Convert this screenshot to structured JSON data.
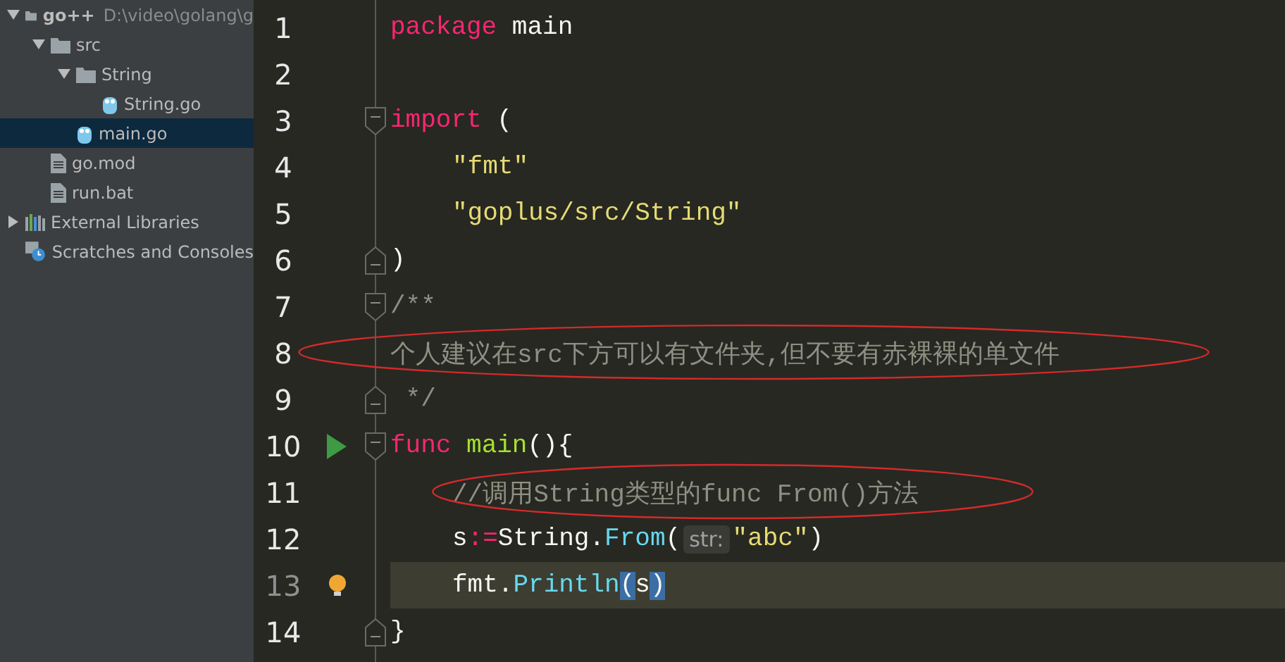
{
  "project_tree": [
    {
      "label": "go++",
      "path": "D:\\video\\golang\\g",
      "kind": "folder",
      "expanded": true,
      "selected": false,
      "children": [
        {
          "label": "src",
          "kind": "folder",
          "expanded": true,
          "selected": false,
          "children": [
            {
              "label": "String",
              "kind": "folder",
              "expanded": true,
              "selected": false,
              "children": [
                {
                  "label": "String.go",
                  "kind": "gofile",
                  "selected": false
                }
              ]
            },
            {
              "label": "main.go",
              "kind": "gofile",
              "selected": true
            }
          ]
        },
        {
          "label": "go.mod",
          "kind": "file",
          "selected": false
        },
        {
          "label": "run.bat",
          "kind": "file",
          "selected": false
        }
      ]
    },
    {
      "label": "External Libraries",
      "kind": "libraries",
      "expanded": false,
      "selected": false
    },
    {
      "label": "Scratches and Consoles",
      "kind": "scratches",
      "selected": false
    }
  ],
  "editor": {
    "lines": [
      {
        "number": "1",
        "current": false,
        "circled": false,
        "indented": false,
        "tokens": [
          {
            "kind": "keyword",
            "text": "package"
          },
          {
            "kind": "plain",
            "text": " main"
          }
        ]
      },
      {
        "number": "2",
        "current": false,
        "circled": false
      },
      {
        "number": "3",
        "current": false,
        "circled": false,
        "indented": false,
        "fold": {
          "kind": "open"
        },
        "tokens": [
          {
            "kind": "keyword",
            "text": "import"
          },
          {
            "kind": "plain",
            "text": " ("
          }
        ]
      },
      {
        "number": "4",
        "current": false,
        "circled": false,
        "indented": true,
        "tokens": [
          {
            "kind": "string",
            "text": "\"fmt\""
          }
        ]
      },
      {
        "number": "5",
        "current": false,
        "circled": false,
        "indented": true,
        "tokens": [
          {
            "kind": "string",
            "text": "\"goplus/src/String\""
          }
        ]
      },
      {
        "number": "6",
        "current": false,
        "circled": false,
        "indented": false,
        "fold": {
          "kind": "close"
        },
        "tokens": [
          {
            "kind": "plain",
            "text": ")"
          }
        ]
      },
      {
        "number": "7",
        "current": false,
        "circled": false,
        "indented": false,
        "fold": {
          "kind": "open"
        },
        "tokens": [
          {
            "kind": "comment",
            "text": "/**"
          }
        ]
      },
      {
        "number": "8",
        "current": false,
        "circled": true,
        "indented": false,
        "tokens": [
          {
            "kind": "comment",
            "text": "个人建议在src下方可以有文件夹,但不要有赤裸裸的单文件"
          }
        ]
      },
      {
        "number": "9",
        "current": false,
        "circled": false,
        "indented": false,
        "fold": {
          "kind": "close"
        },
        "tokens": [
          {
            "kind": "comment",
            "text": " */"
          }
        ]
      },
      {
        "number": "10",
        "current": false,
        "circled": false,
        "indented": false,
        "fold": {
          "kind": "open"
        },
        "gutter_icon": {
          "kind": "run"
        },
        "tokens": [
          {
            "kind": "keyword",
            "text": "func"
          },
          {
            "kind": "function",
            "text": " main"
          },
          {
            "kind": "plain",
            "text": "(){"
          }
        ]
      },
      {
        "number": "11",
        "current": false,
        "circled": true,
        "indented": true,
        "tokens": [
          {
            "kind": "comment",
            "text": "//调用String类型的func From()方法"
          }
        ]
      },
      {
        "number": "12",
        "current": false,
        "circled": false,
        "indented": true,
        "tokens": [
          {
            "kind": "plain",
            "text": "s"
          },
          {
            "kind": "operator",
            "text": ":="
          },
          {
            "kind": "plain",
            "text": "String."
          },
          {
            "kind": "call",
            "text": "From"
          },
          {
            "kind": "plain",
            "text": "("
          },
          {
            "kind": "hint",
            "text": "str:"
          },
          {
            "kind": "string",
            "text": "\"abc\""
          },
          {
            "kind": "plain",
            "text": ")"
          }
        ]
      },
      {
        "number": "13",
        "current": true,
        "circled": false,
        "indented": true,
        "gutter_icon": {
          "kind": "bulb"
        },
        "tokens": [
          {
            "kind": "plain",
            "text": "fmt."
          },
          {
            "kind": "call",
            "text": "Println"
          },
          {
            "kind": "brace",
            "text": "("
          },
          {
            "kind": "plain",
            "text": "s"
          },
          {
            "kind": "brace",
            "text": ")"
          }
        ]
      },
      {
        "number": "14",
        "current": false,
        "circled": false,
        "indented": false,
        "fold": {
          "kind": "close"
        },
        "tokens": [
          {
            "kind": "plain",
            "text": "}"
          }
        ]
      }
    ]
  }
}
